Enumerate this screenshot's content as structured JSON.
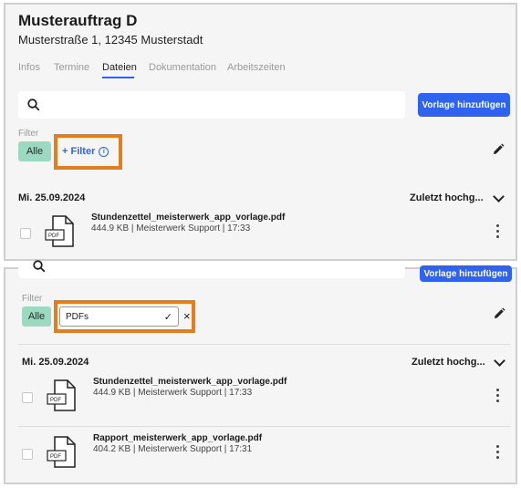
{
  "order": {
    "title": "Musterauftrag D",
    "address": "Musterstraße 1, 12345 Musterstadt"
  },
  "tabs": [
    {
      "label": "Infos"
    },
    {
      "label": "Termine"
    },
    {
      "label": "Dateien",
      "active": true
    },
    {
      "label": "Dokumentation"
    },
    {
      "label": "Arbeitszeiten"
    }
  ],
  "toolbar": {
    "add_template_label": "Vorlage hinzufügen"
  },
  "filter": {
    "label": "Filter",
    "chip_all": "Alle",
    "add_filter_label": "+ Filter",
    "info_glyph": "i",
    "active_filter_value": "PDFs",
    "confirm_glyph": "✓",
    "clear_glyph": "×"
  },
  "group": {
    "date": "Mi. 25.09.2024",
    "sort_label": "Zuletzt hochg..."
  },
  "files": [
    {
      "name": "Stundenzettel_meisterwerk_app_vorlage.pdf",
      "meta": "444.9 KB | Meisterwerk Support | 17:33",
      "type_label": "PDF"
    },
    {
      "name": "Rapport_meisterwerk_app_vorlage.pdf",
      "meta": "404.2 KB | Meisterwerk Support | 17:31",
      "type_label": "PDF"
    }
  ],
  "colors": {
    "accent": "#2f63ef",
    "chip": "#9bd9c0",
    "highlight": "#e37e1a"
  }
}
